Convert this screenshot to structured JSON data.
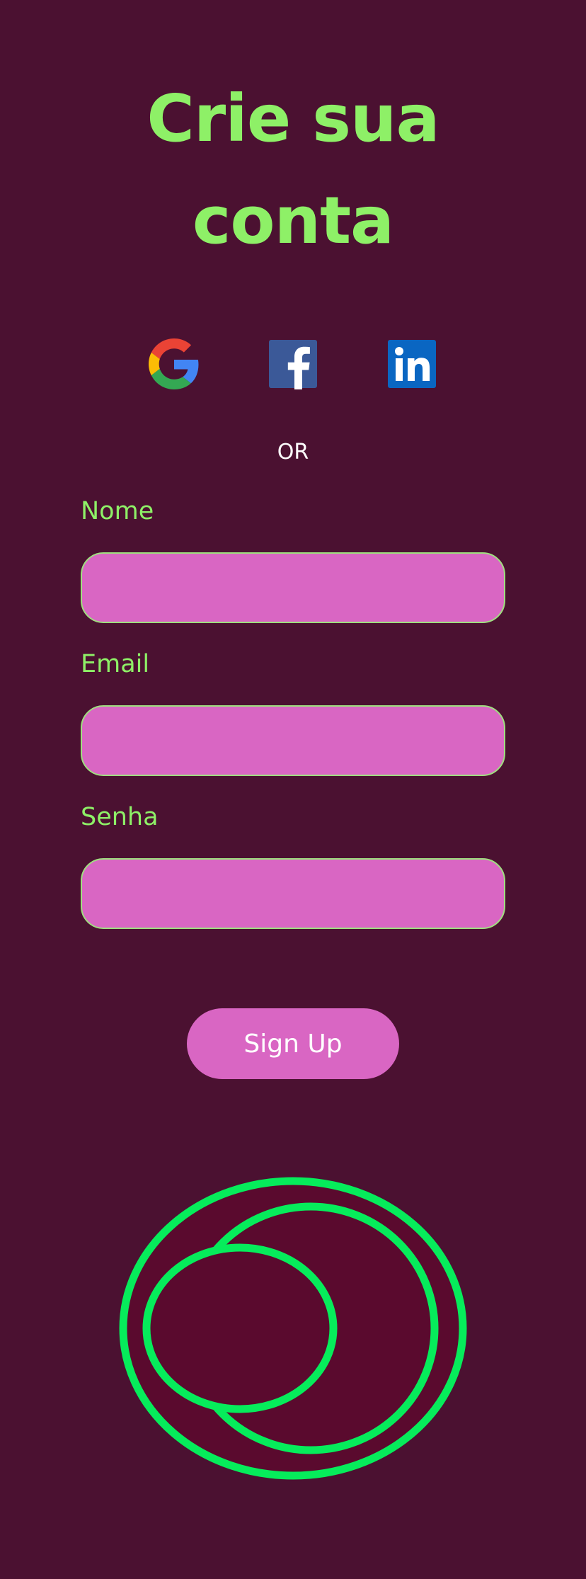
{
  "page": {
    "title_line1": "Crie sua",
    "title_line2": "conta",
    "background_color": "#4b1131",
    "accent_color": "#8ef067"
  },
  "social": [
    {
      "name": "Google",
      "icon": "google-icon"
    },
    {
      "name": "Facebook",
      "icon": "facebook-icon"
    },
    {
      "name": "LinkedIn",
      "icon": "linkedin-icon"
    }
  ],
  "divider": {
    "text": "OR"
  },
  "form": {
    "name": {
      "label": "Nome",
      "value": "",
      "placeholder": ""
    },
    "email": {
      "label": "Email",
      "value": "",
      "placeholder": ""
    },
    "password": {
      "label": "Senha",
      "value": "",
      "placeholder": ""
    },
    "field_color": "#d966c3",
    "submit_label": "Sign Up"
  },
  "logo": {
    "icon": "rings-logo",
    "stroke_color": "#06ec5b",
    "fill_color": "#5a0a2e"
  }
}
